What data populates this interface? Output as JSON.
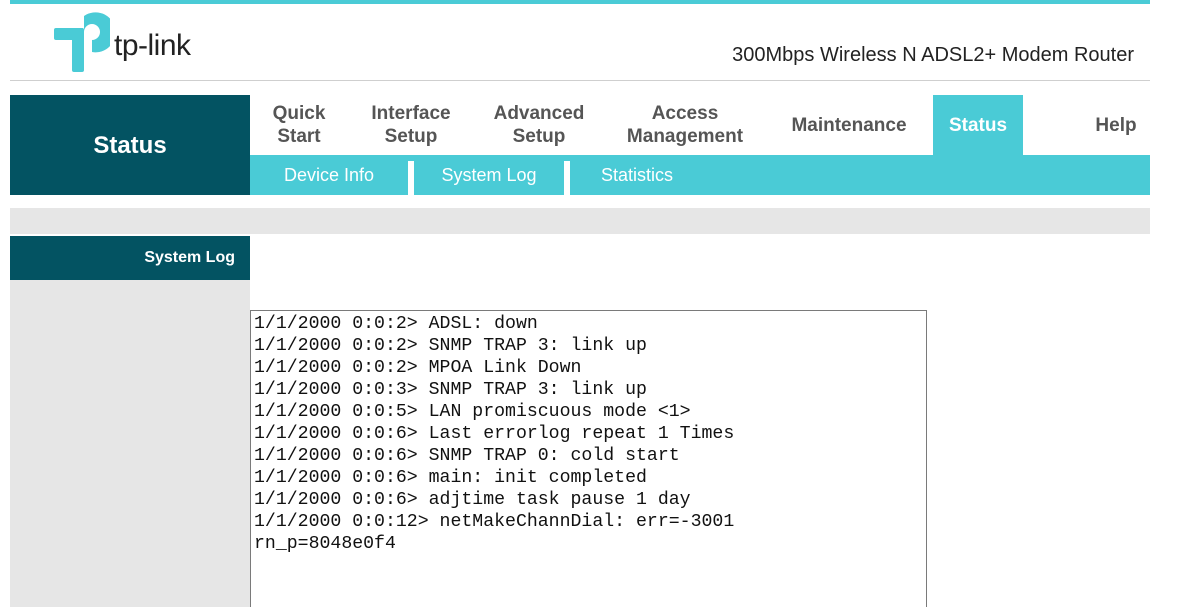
{
  "brand": {
    "logo_text": "tp-link",
    "model_title": "300Mbps Wireless N ADSL2+ Modem Router",
    "accent_color": "#4acbd6",
    "dark_color": "#035362"
  },
  "section_badge": "Status",
  "main_nav": [
    {
      "line1": "Quick",
      "line2": "Start"
    },
    {
      "line1": "Interface",
      "line2": "Setup"
    },
    {
      "line1": "Advanced",
      "line2": "Setup"
    },
    {
      "line1": "Access",
      "line2": "Management"
    },
    {
      "line1": "Maintenance",
      "line2": ""
    },
    {
      "line1": "Status",
      "line2": ""
    },
    {
      "line1": "Help",
      "line2": ""
    }
  ],
  "sub_nav": [
    "Device Info",
    "System Log",
    "Statistics"
  ],
  "sidebar": {
    "label": "System Log"
  },
  "system_log": "1/1/2000 0:0:2> ADSL: down\n1/1/2000 0:0:2> SNMP TRAP 3: link up\n1/1/2000 0:0:2> MPOA Link Down\n1/1/2000 0:0:3> SNMP TRAP 3: link up\n1/1/2000 0:0:5> LAN promiscuous mode <1>\n1/1/2000 0:0:6> Last errorlog repeat 1 Times\n1/1/2000 0:0:6> SNMP TRAP 0: cold start\n1/1/2000 0:0:6> main: init completed\n1/1/2000 0:0:6> adjtime task pause 1 day\n1/1/2000 0:0:12> netMakeChannDial: err=-3001\nrn_p=8048e0f4"
}
